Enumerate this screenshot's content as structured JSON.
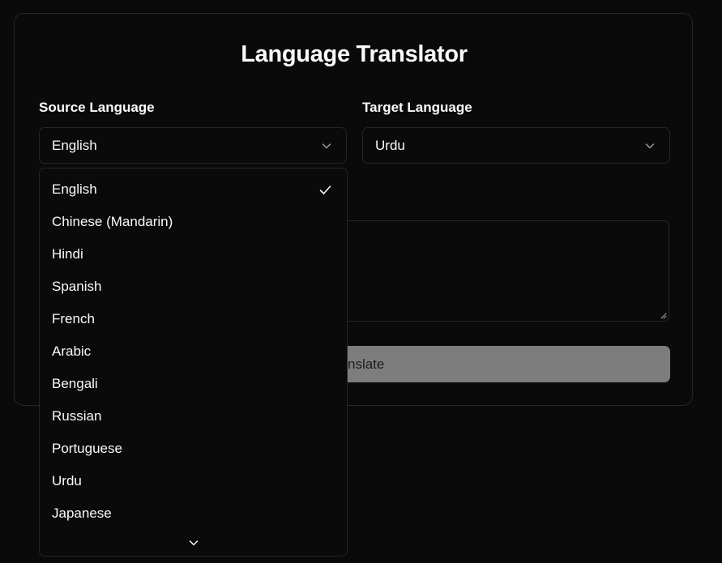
{
  "title": "Language Translator",
  "source": {
    "label": "Source Language",
    "value": "English"
  },
  "target": {
    "label": "Target Language",
    "value": "Urdu"
  },
  "translate_button": {
    "label_visible": "nslate"
  },
  "dropdown": {
    "selected": "English",
    "options": [
      "English",
      "Chinese (Mandarin)",
      "Hindi",
      "Spanish",
      "French",
      "Arabic",
      "Bengali",
      "Russian",
      "Portuguese",
      "Urdu",
      "Japanese"
    ]
  },
  "icons": {
    "select_chevron": "chevron-down-icon",
    "selected_mark": "check-icon",
    "scroll_indicator": "chevron-down-icon",
    "textarea_resize": "resize-handle-icon"
  },
  "colors": {
    "background": "#0a0a0a",
    "border": "#262626",
    "text": "#fafafa",
    "button_disabled_bg": "#7d7d7d",
    "button_disabled_text": "#1c1c1c"
  }
}
